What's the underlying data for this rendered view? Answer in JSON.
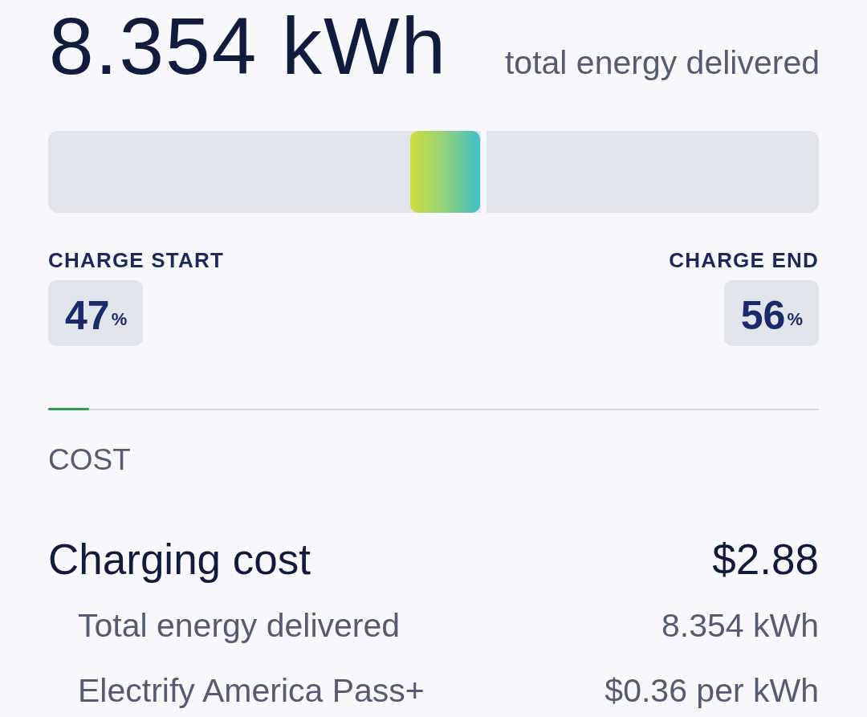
{
  "summary": {
    "value": "8.354 kWh",
    "label": "total energy delivered"
  },
  "charge": {
    "start": {
      "label": "CHARGE START",
      "value": "47",
      "unit": "%",
      "level": 0.47
    },
    "end": {
      "label": "CHARGE END",
      "value": "56",
      "unit": "%",
      "level": 0.56
    }
  },
  "cost": {
    "heading": "COST",
    "total": {
      "label": "Charging cost",
      "value": "$2.88"
    },
    "items": [
      {
        "label": "Total energy delivered",
        "value": "8.354 kWh"
      },
      {
        "label": "Electrify America Pass+",
        "value": "$0.36 per kWh"
      }
    ]
  }
}
